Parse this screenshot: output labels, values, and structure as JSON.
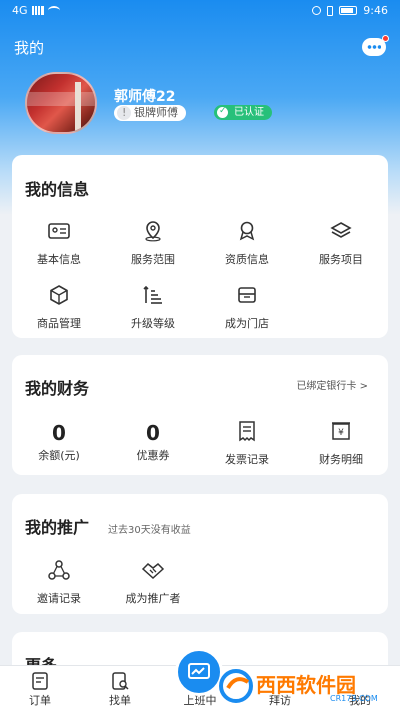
{
  "status": {
    "left": "4G",
    "right": "9:46"
  },
  "header": {
    "title": "我的"
  },
  "profile": {
    "name": "郭师傅22",
    "level": "银牌师傅",
    "cert": "已认证"
  },
  "info": {
    "title": "我的信息",
    "items": [
      {
        "label": "基本信息",
        "icon": "id-card-icon"
      },
      {
        "label": "服务范围",
        "icon": "location-icon"
      },
      {
        "label": "资质信息",
        "icon": "medal-icon"
      },
      {
        "label": "服务项目",
        "icon": "layers-icon"
      },
      {
        "label": "商品管理",
        "icon": "box-icon"
      },
      {
        "label": "升级等级",
        "icon": "levels-icon"
      },
      {
        "label": "成为门店",
        "icon": "store-icon"
      }
    ]
  },
  "finance": {
    "title": "我的财务",
    "bank_link": "已绑定银行卡 >",
    "balance_value": "0",
    "balance_label": "余额(元)",
    "coupon_value": "0",
    "coupon_label": "优惠券",
    "invoice_label": "发票记录",
    "detail_label": "财务明细"
  },
  "promo": {
    "title": "我的推广",
    "note": "过去30天没有收益",
    "invite_label": "邀请记录",
    "become_label": "成为推广者"
  },
  "more": {
    "title": "更多"
  },
  "tabbar": {
    "orders": "订单",
    "find": "找单",
    "work": "上班中",
    "visit": "拜访",
    "mine": "我的"
  },
  "watermark": {
    "text": "西西软件园",
    "sub": "CR173.COM"
  },
  "colors": {
    "primary": "#1a8cf0",
    "cert": "#27c07a"
  }
}
